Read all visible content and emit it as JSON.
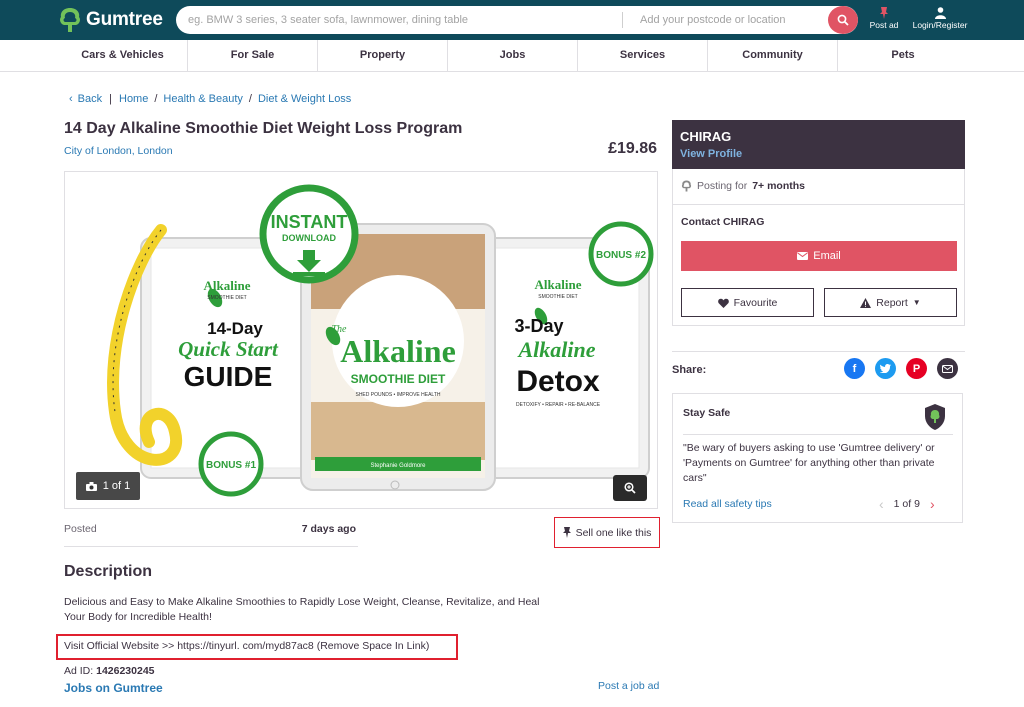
{
  "header": {
    "logo_text": "Gumtree",
    "search_placeholder": "eg. BMW 3 series, 3 seater sofa, lawnmower, dining table",
    "location_placeholder": "Add your postcode or location",
    "post_ad_label": "Post ad",
    "login_label": "Login/Register",
    "brand_color": "#0e4a5a",
    "accent_color": "#e05464"
  },
  "nav": {
    "categories": [
      "Cars & Vehicles",
      "For Sale",
      "Property",
      "Jobs",
      "Services",
      "Community",
      "Pets"
    ]
  },
  "breadcrumb": {
    "back": "Back",
    "items": [
      "Home",
      "Health & Beauty",
      "Diet & Weight Loss"
    ]
  },
  "listing": {
    "title": "14 Day Alkaline Smoothie Diet Weight Loss Program",
    "location": "City of London, London",
    "price": "£19.86",
    "image_counter": "1 of 1",
    "posted_label": "Posted",
    "posted_value": "7 days ago",
    "sell_one_label": "Sell one like this",
    "description_heading": "Description",
    "description_text": "Delicious and Easy to Make Alkaline Smoothies to Rapidly Lose Weight, Cleanse, Revitalize, and Heal Your Body for Incredible Health!",
    "visit_text": "Visit Official Website >> https://tinyurl. com/myd87ac8 (Remove Space In Link)",
    "ad_id_label": "Ad ID:",
    "ad_id_value": "1426230245",
    "jobs_link": "Jobs on Gumtree",
    "post_job_link": "Post a job ad"
  },
  "product_image": {
    "instant": "INSTANT",
    "download": "DOWNLOAD",
    "bonus2": "BONUS #2",
    "bonus1": "BONUS #1",
    "left_brand": "Alkaline",
    "left_brand_sub": "SMOOTHIE DIET",
    "left_line1": "14-Day",
    "left_line2": "Quick Start",
    "left_line3": "GUIDE",
    "center_the": "The",
    "center_title": "Alkaline",
    "center_sub": "SMOOTHIE DIET",
    "center_tag": "SHED POUNDS • IMPROVE HEALTH",
    "center_author": "Stephanie Goldmore",
    "right_brand": "Alkaline",
    "right_brand_sub": "SMOOTHIE DIET",
    "right_line1": "3-Day",
    "right_line2": "Alkaline",
    "right_line3": "Detox",
    "right_tag": "DETOXIFY • REPAIR • RE-BALANCE"
  },
  "seller": {
    "name": "CHIRAG",
    "view_profile": "View Profile",
    "posting_prefix": "Posting for",
    "posting_duration": "7+ months",
    "contact_label": "Contact CHIRAG",
    "email_label": "Email",
    "favourite_label": "Favourite",
    "report_label": "Report"
  },
  "share": {
    "label": "Share:",
    "icons": [
      "facebook-icon",
      "twitter-icon",
      "pinterest-icon",
      "email-icon"
    ]
  },
  "stay_safe": {
    "title": "Stay Safe",
    "quote": "\"Be wary of buyers asking to use 'Gumtree delivery' or 'Payments on Gumtree' for anything other than private cars\"",
    "link": "Read all safety tips",
    "pager": "1 of 9"
  }
}
